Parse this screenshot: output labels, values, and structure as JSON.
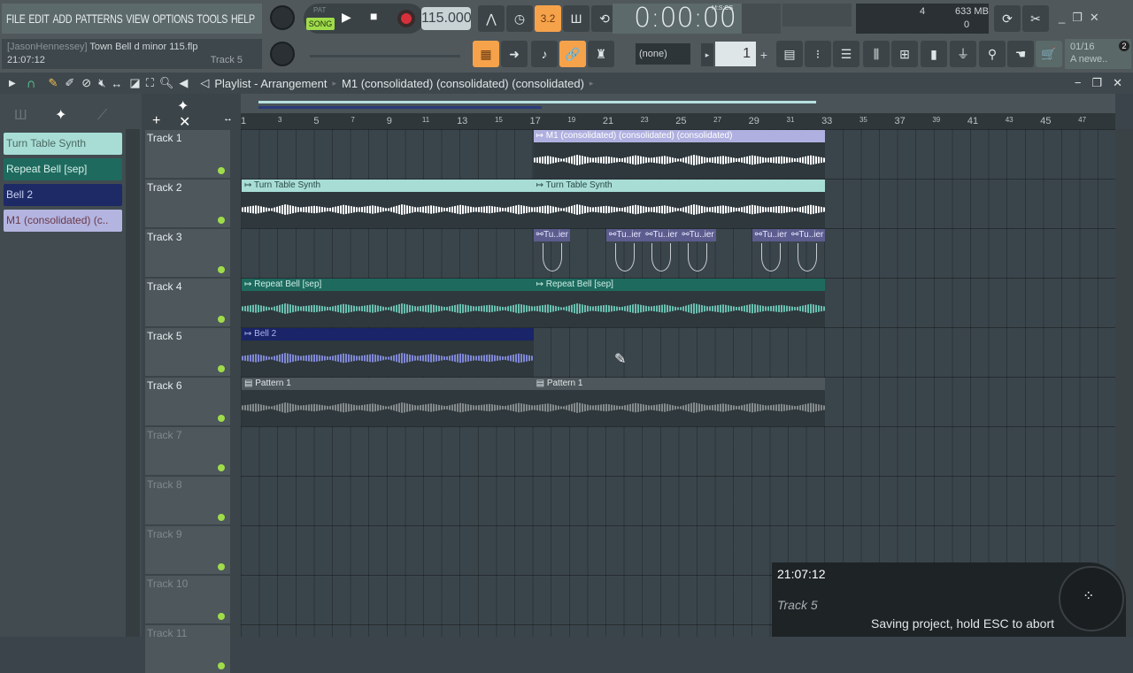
{
  "menu": [
    "FILE",
    "EDIT",
    "ADD",
    "PATTERNS",
    "VIEW",
    "OPTIONS",
    "TOOLS",
    "HELP"
  ],
  "info": {
    "user": "[JasonHennessey]",
    "file": "Town Bell d minor 115.flp",
    "time": "21:07:12",
    "hint": "Track 5"
  },
  "transport": {
    "pat": "PAT",
    "song": "SONG",
    "tempo": "115.000",
    "time": "0:00:00",
    "time_format": "M:S:CS",
    "snap": "3.2"
  },
  "cpu": {
    "voices": "4",
    "memory": "633 MB",
    "poly": "0"
  },
  "pattern_selector": "(none)",
  "pattern_number": "1",
  "news": {
    "count": "01/16",
    "text": "A newe..",
    "badge": "2"
  },
  "playlist": {
    "title": "Playlist - Arrangement",
    "current": "M1 (consolidated) (consolidated) (consolidated)"
  },
  "picker": [
    {
      "label": "Turn Table Synth",
      "bg": "#a8ddd6",
      "fg": "#4a6a60"
    },
    {
      "label": "Repeat Bell [sep]",
      "bg": "#1e6a5e",
      "fg": "#d8f0ea"
    },
    {
      "label": "Bell 2",
      "bg": "#1e2a66",
      "fg": "#c8d0f0"
    },
    {
      "label": "M1 (consolidated) (c..",
      "bg": "#b4b4e0",
      "fg": "#6a3a4a"
    }
  ],
  "tracks": [
    "Track 1",
    "Track 2",
    "Track 3",
    "Track 4",
    "Track 5",
    "Track 6",
    "Track 7",
    "Track 8",
    "Track 9",
    "Track 10",
    "Track 11"
  ],
  "ruler": [
    "1",
    "3",
    "5",
    "7",
    "9",
    "11",
    "13",
    "15",
    "17",
    "19",
    "21",
    "23",
    "25",
    "27",
    "29",
    "31",
    "33",
    "35",
    "37",
    "39",
    "41",
    "43",
    "45",
    "47"
  ],
  "clips": {
    "m1": "M1 (consolidated) (consolidated) (consolidated)",
    "synth": "Turn Table Synth",
    "auto": "Tu..ier",
    "bell": "Repeat Bell [sep]",
    "bell2": "Bell 2",
    "pattern": "Pattern 1"
  },
  "toast": {
    "time": "21:07:12",
    "track": "Track 5",
    "message": "Saving project, hold ESC to abort"
  }
}
